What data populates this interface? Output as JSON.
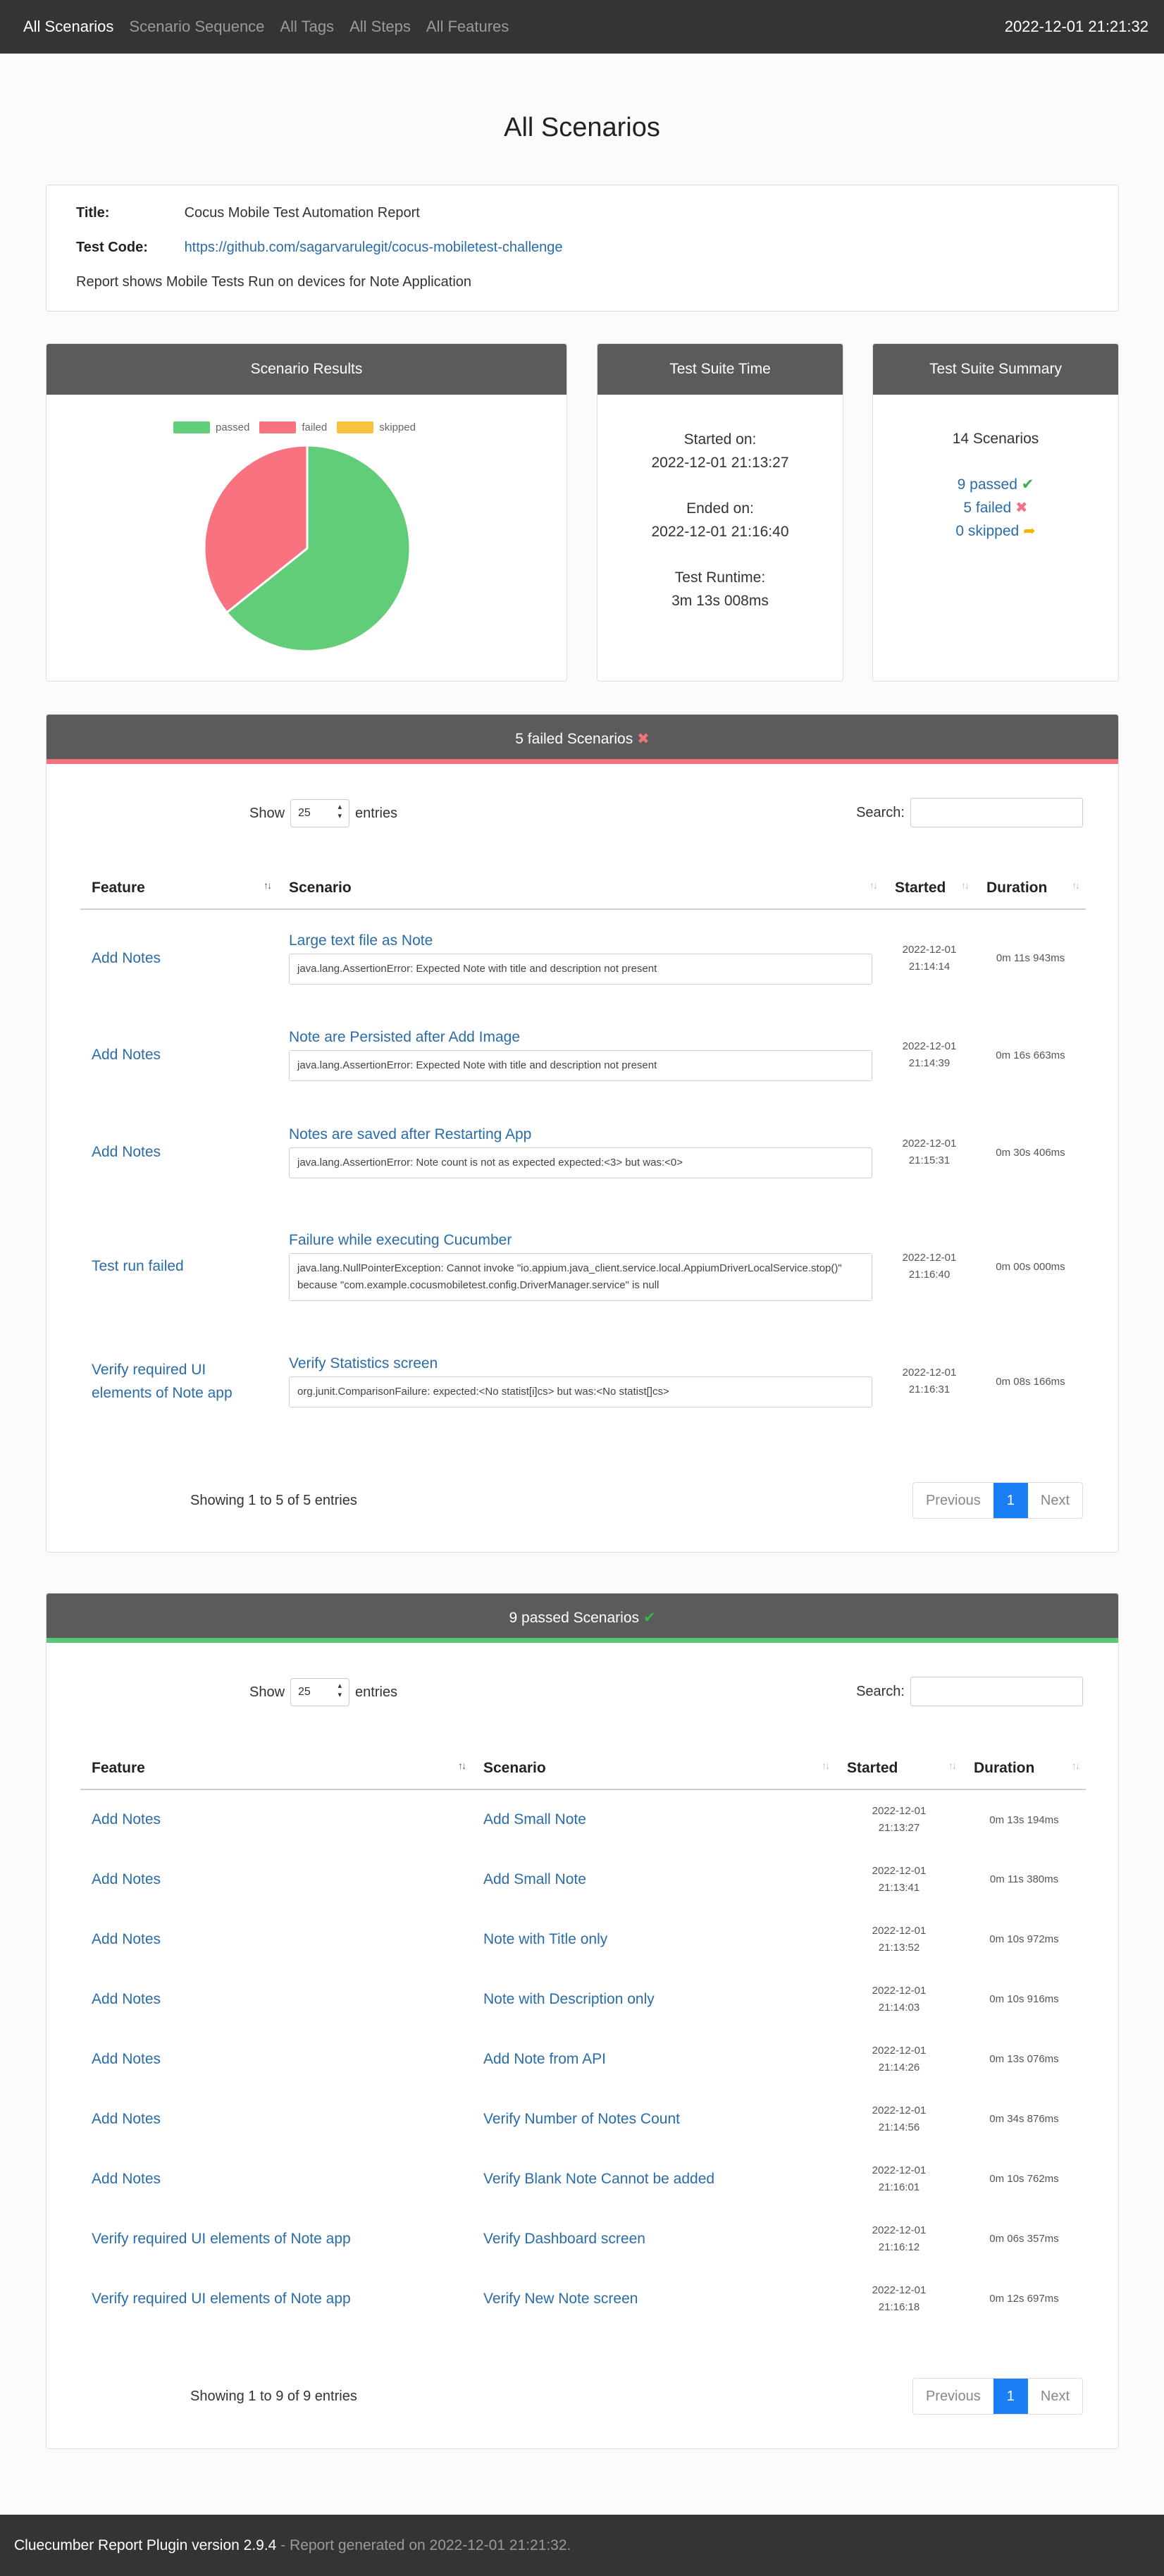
{
  "nav": {
    "items": [
      "All Scenarios",
      "Scenario Sequence",
      "All Tags",
      "All Steps",
      "All Features"
    ],
    "datetime": "2022-12-01 21:21:32"
  },
  "page_title": "All Scenarios",
  "info": {
    "title_label": "Title:",
    "title_value": "Cocus Mobile Test Automation Report",
    "code_label": "Test Code:",
    "code_link": "https://github.com/sagarvarulegit/cocus-mobiletest-challenge",
    "description": "Report shows Mobile Tests Run on devices for Note Application"
  },
  "results": {
    "header": "Scenario Results",
    "legend": [
      "passed",
      "failed",
      "skipped"
    ],
    "colors": {
      "passed": "#62cd79",
      "failed": "#f8727f",
      "skipped": "#f6c240"
    },
    "chart_data": {
      "type": "pie",
      "labels": [
        "passed",
        "failed",
        "skipped"
      ],
      "values": [
        9,
        5,
        0
      ]
    }
  },
  "suite_time": {
    "header": "Test Suite Time",
    "started_label": "Started on:",
    "started_value": "2022-12-01 21:13:27",
    "ended_label": "Ended on:",
    "ended_value": "2022-12-01 21:16:40",
    "runtime_label": "Test Runtime:",
    "runtime_value": "3m 13s 008ms"
  },
  "summary": {
    "header": "Test Suite Summary",
    "total": "14 Scenarios",
    "passed": "9 passed",
    "failed": "5 failed",
    "skipped": "0 skipped"
  },
  "failed_section": {
    "header": "5 failed Scenarios",
    "show_label": "Show",
    "show_value": "25",
    "entries_label": "entries",
    "search_label": "Search:",
    "columns": [
      "Feature",
      "Scenario",
      "Started",
      "Duration"
    ],
    "rows": [
      {
        "feature": "Add Notes",
        "scenario": "Large text file as Note",
        "error": "java.lang.AssertionError: Expected Note with title and description not present",
        "date": "2022-12-01",
        "time": "21:14:14",
        "duration": "0m 11s 943ms"
      },
      {
        "feature": "Add Notes",
        "scenario": "Note are Persisted after Add Image",
        "error": "java.lang.AssertionError: Expected Note with title and description not present",
        "date": "2022-12-01",
        "time": "21:14:39",
        "duration": "0m 16s 663ms"
      },
      {
        "feature": "Add Notes",
        "scenario": "Notes are saved after Restarting App",
        "error": "java.lang.AssertionError: Note count is not as expected expected:<3> but was:<0>",
        "date": "2022-12-01",
        "time": "21:15:31",
        "duration": "0m 30s 406ms"
      },
      {
        "feature": "Test run failed",
        "scenario": "Failure while executing Cucumber",
        "error": "java.lang.NullPointerException: Cannot invoke \"io.appium.java_client.service.local.AppiumDriverLocalService.stop()\" because \"com.example.cocusmobiletest.config.DriverManager.service\" is null",
        "date": "2022-12-01",
        "time": "21:16:40",
        "duration": "0m 00s 000ms"
      },
      {
        "feature": "Verify required UI elements of Note app",
        "scenario": "Verify Statistics screen",
        "error": "org.junit.ComparisonFailure: expected:<No statist[i]cs> but was:<No statist[]cs>",
        "date": "2022-12-01",
        "time": "21:16:31",
        "duration": "0m 08s 166ms"
      }
    ],
    "showing": "Showing 1 to 5 of 5 entries",
    "pager": {
      "prev": "Previous",
      "current": "1",
      "next": "Next"
    }
  },
  "passed_section": {
    "header": "9 passed Scenarios",
    "show_label": "Show",
    "show_value": "25",
    "entries_label": "entries",
    "search_label": "Search:",
    "columns": [
      "Feature",
      "Scenario",
      "Started",
      "Duration"
    ],
    "rows": [
      {
        "feature": "Add Notes",
        "scenario": "Add Small Note",
        "date": "2022-12-01",
        "time": "21:13:27",
        "duration": "0m 13s 194ms"
      },
      {
        "feature": "Add Notes",
        "scenario": "Add Small Note",
        "date": "2022-12-01",
        "time": "21:13:41",
        "duration": "0m 11s 380ms"
      },
      {
        "feature": "Add Notes",
        "scenario": "Note with Title only",
        "date": "2022-12-01",
        "time": "21:13:52",
        "duration": "0m 10s 972ms"
      },
      {
        "feature": "Add Notes",
        "scenario": "Note with Description only",
        "date": "2022-12-01",
        "time": "21:14:03",
        "duration": "0m 10s 916ms"
      },
      {
        "feature": "Add Notes",
        "scenario": "Add Note from API",
        "date": "2022-12-01",
        "time": "21:14:26",
        "duration": "0m 13s 076ms"
      },
      {
        "feature": "Add Notes",
        "scenario": "Verify Number of Notes Count",
        "date": "2022-12-01",
        "time": "21:14:56",
        "duration": "0m 34s 876ms"
      },
      {
        "feature": "Add Notes",
        "scenario": "Verify Blank Note Cannot be added",
        "date": "2022-12-01",
        "time": "21:16:01",
        "duration": "0m 10s 762ms"
      },
      {
        "feature": "Verify required UI elements of Note app",
        "scenario": "Verify Dashboard screen",
        "date": "2022-12-01",
        "time": "21:16:12",
        "duration": "0m 06s 357ms"
      },
      {
        "feature": "Verify required UI elements of Note app",
        "scenario": "Verify New Note screen",
        "date": "2022-12-01",
        "time": "21:16:18",
        "duration": "0m 12s 697ms"
      }
    ],
    "showing": "Showing 1 to 9 of 9 entries",
    "pager": {
      "prev": "Previous",
      "current": "1",
      "next": "Next"
    }
  },
  "footer": {
    "plugin": "Cluecumber Report Plugin version 2.9.4",
    "generated": " - Report generated on 2022-12-01 21:21:32."
  }
}
